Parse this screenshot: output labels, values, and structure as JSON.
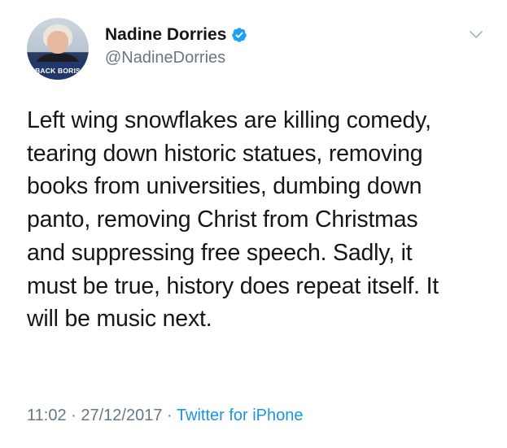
{
  "author": {
    "display_name": "Nadine Dorries",
    "handle": "@NadineDorries",
    "verified": true,
    "avatar_banner_text": "BACK BORIS"
  },
  "tweet": {
    "lines": [
      "Left wing snowflakes are killing comedy,",
      "tearing down historic statues, removing",
      "books from universities, dumbing down",
      "panto, removing Christ from Christmas",
      "and suppressing free speech. Sadly, it",
      "must be true, history does repeat itself. It",
      "will be music next."
    ],
    "time": "11:02",
    "separator": "·",
    "date": "27/12/2017",
    "source": "Twitter for iPhone"
  },
  "colors": {
    "text": "#14171a",
    "secondary": "#657786",
    "link": "#1b95e0",
    "verified": "#1da1f2"
  },
  "icons": {
    "verified": "verified-badge-icon",
    "menu": "chevron-down-icon"
  }
}
